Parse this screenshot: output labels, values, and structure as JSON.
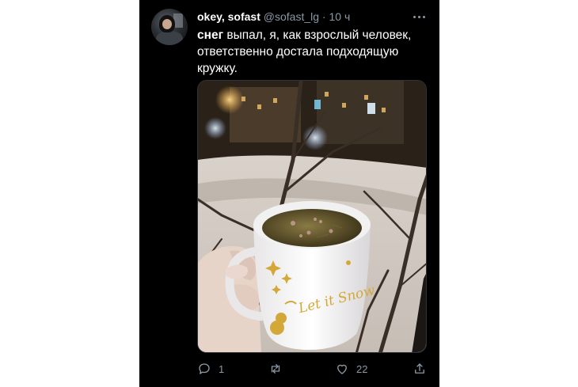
{
  "tweet": {
    "author": {
      "name": "okey, sofast",
      "handle": "@sofast_lg",
      "separator": "·",
      "time": "10 ч"
    },
    "text": {
      "bold": "снег",
      "rest": " выпал, я, как взрослый человек, ответственно достала подходящую кружку."
    },
    "mug_lettering": "Let it Snow",
    "actions": {
      "reply_count": "1",
      "retweet_count": "",
      "like_count": "22"
    }
  }
}
